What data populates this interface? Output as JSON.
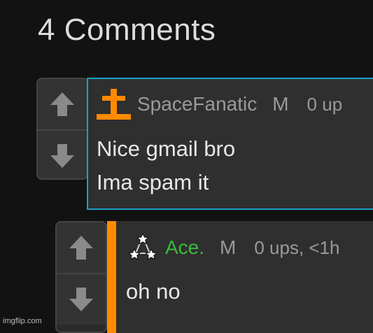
{
  "header": {
    "title": "4 Comments"
  },
  "comments": [
    {
      "username": "SpaceFanatic",
      "gender": "M",
      "stats": "0 up",
      "text_lines": [
        "Nice gmail bro",
        "Ima spam it"
      ],
      "badge_icon": "orange-cross-badge-icon",
      "border_color": "#1aa0c8"
    },
    {
      "username": "Ace.",
      "gender": "M",
      "stats": "0 ups, <1h",
      "text_lines": [
        "oh no"
      ],
      "badge_icon": "three-stars-badge-icon",
      "accent_color": "#ff8a00"
    }
  ],
  "watermark": "imgflip.com",
  "colors": {
    "background": "#121212",
    "panel": "#2f2f2f",
    "username_green": "#3cba3c",
    "orange": "#ff8a00",
    "blue": "#1aa0c8"
  }
}
